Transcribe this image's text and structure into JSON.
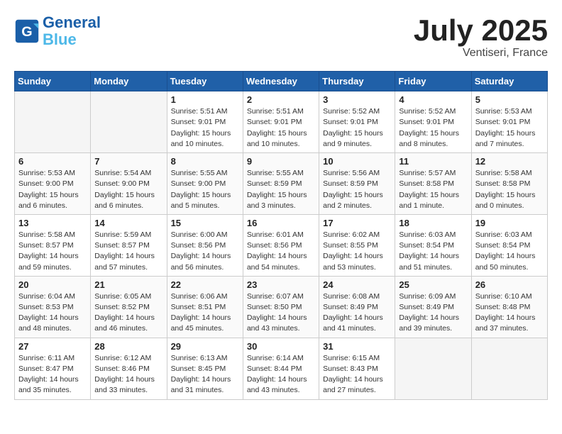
{
  "header": {
    "logo_line1": "General",
    "logo_line2": "Blue",
    "month": "July 2025",
    "location": "Ventiseri, France"
  },
  "weekdays": [
    "Sunday",
    "Monday",
    "Tuesday",
    "Wednesday",
    "Thursday",
    "Friday",
    "Saturday"
  ],
  "weeks": [
    [
      {
        "day": null
      },
      {
        "day": null
      },
      {
        "day": "1",
        "sunrise": "Sunrise: 5:51 AM",
        "sunset": "Sunset: 9:01 PM",
        "daylight": "Daylight: 15 hours and 10 minutes."
      },
      {
        "day": "2",
        "sunrise": "Sunrise: 5:51 AM",
        "sunset": "Sunset: 9:01 PM",
        "daylight": "Daylight: 15 hours and 10 minutes."
      },
      {
        "day": "3",
        "sunrise": "Sunrise: 5:52 AM",
        "sunset": "Sunset: 9:01 PM",
        "daylight": "Daylight: 15 hours and 9 minutes."
      },
      {
        "day": "4",
        "sunrise": "Sunrise: 5:52 AM",
        "sunset": "Sunset: 9:01 PM",
        "daylight": "Daylight: 15 hours and 8 minutes."
      },
      {
        "day": "5",
        "sunrise": "Sunrise: 5:53 AM",
        "sunset": "Sunset: 9:01 PM",
        "daylight": "Daylight: 15 hours and 7 minutes."
      }
    ],
    [
      {
        "day": "6",
        "sunrise": "Sunrise: 5:53 AM",
        "sunset": "Sunset: 9:00 PM",
        "daylight": "Daylight: 15 hours and 6 minutes."
      },
      {
        "day": "7",
        "sunrise": "Sunrise: 5:54 AM",
        "sunset": "Sunset: 9:00 PM",
        "daylight": "Daylight: 15 hours and 6 minutes."
      },
      {
        "day": "8",
        "sunrise": "Sunrise: 5:55 AM",
        "sunset": "Sunset: 9:00 PM",
        "daylight": "Daylight: 15 hours and 5 minutes."
      },
      {
        "day": "9",
        "sunrise": "Sunrise: 5:55 AM",
        "sunset": "Sunset: 8:59 PM",
        "daylight": "Daylight: 15 hours and 3 minutes."
      },
      {
        "day": "10",
        "sunrise": "Sunrise: 5:56 AM",
        "sunset": "Sunset: 8:59 PM",
        "daylight": "Daylight: 15 hours and 2 minutes."
      },
      {
        "day": "11",
        "sunrise": "Sunrise: 5:57 AM",
        "sunset": "Sunset: 8:58 PM",
        "daylight": "Daylight: 15 hours and 1 minute."
      },
      {
        "day": "12",
        "sunrise": "Sunrise: 5:58 AM",
        "sunset": "Sunset: 8:58 PM",
        "daylight": "Daylight: 15 hours and 0 minutes."
      }
    ],
    [
      {
        "day": "13",
        "sunrise": "Sunrise: 5:58 AM",
        "sunset": "Sunset: 8:57 PM",
        "daylight": "Daylight: 14 hours and 59 minutes."
      },
      {
        "day": "14",
        "sunrise": "Sunrise: 5:59 AM",
        "sunset": "Sunset: 8:57 PM",
        "daylight": "Daylight: 14 hours and 57 minutes."
      },
      {
        "day": "15",
        "sunrise": "Sunrise: 6:00 AM",
        "sunset": "Sunset: 8:56 PM",
        "daylight": "Daylight: 14 hours and 56 minutes."
      },
      {
        "day": "16",
        "sunrise": "Sunrise: 6:01 AM",
        "sunset": "Sunset: 8:56 PM",
        "daylight": "Daylight: 14 hours and 54 minutes."
      },
      {
        "day": "17",
        "sunrise": "Sunrise: 6:02 AM",
        "sunset": "Sunset: 8:55 PM",
        "daylight": "Daylight: 14 hours and 53 minutes."
      },
      {
        "day": "18",
        "sunrise": "Sunrise: 6:03 AM",
        "sunset": "Sunset: 8:54 PM",
        "daylight": "Daylight: 14 hours and 51 minutes."
      },
      {
        "day": "19",
        "sunrise": "Sunrise: 6:03 AM",
        "sunset": "Sunset: 8:54 PM",
        "daylight": "Daylight: 14 hours and 50 minutes."
      }
    ],
    [
      {
        "day": "20",
        "sunrise": "Sunrise: 6:04 AM",
        "sunset": "Sunset: 8:53 PM",
        "daylight": "Daylight: 14 hours and 48 minutes."
      },
      {
        "day": "21",
        "sunrise": "Sunrise: 6:05 AM",
        "sunset": "Sunset: 8:52 PM",
        "daylight": "Daylight: 14 hours and 46 minutes."
      },
      {
        "day": "22",
        "sunrise": "Sunrise: 6:06 AM",
        "sunset": "Sunset: 8:51 PM",
        "daylight": "Daylight: 14 hours and 45 minutes."
      },
      {
        "day": "23",
        "sunrise": "Sunrise: 6:07 AM",
        "sunset": "Sunset: 8:50 PM",
        "daylight": "Daylight: 14 hours and 43 minutes."
      },
      {
        "day": "24",
        "sunrise": "Sunrise: 6:08 AM",
        "sunset": "Sunset: 8:49 PM",
        "daylight": "Daylight: 14 hours and 41 minutes."
      },
      {
        "day": "25",
        "sunrise": "Sunrise: 6:09 AM",
        "sunset": "Sunset: 8:49 PM",
        "daylight": "Daylight: 14 hours and 39 minutes."
      },
      {
        "day": "26",
        "sunrise": "Sunrise: 6:10 AM",
        "sunset": "Sunset: 8:48 PM",
        "daylight": "Daylight: 14 hours and 37 minutes."
      }
    ],
    [
      {
        "day": "27",
        "sunrise": "Sunrise: 6:11 AM",
        "sunset": "Sunset: 8:47 PM",
        "daylight": "Daylight: 14 hours and 35 minutes."
      },
      {
        "day": "28",
        "sunrise": "Sunrise: 6:12 AM",
        "sunset": "Sunset: 8:46 PM",
        "daylight": "Daylight: 14 hours and 33 minutes."
      },
      {
        "day": "29",
        "sunrise": "Sunrise: 6:13 AM",
        "sunset": "Sunset: 8:45 PM",
        "daylight": "Daylight: 14 hours and 31 minutes."
      },
      {
        "day": "30",
        "sunrise": "Sunrise: 6:14 AM",
        "sunset": "Sunset: 8:44 PM",
        "daylight": "Daylight: 14 hours and 43 minutes."
      },
      {
        "day": "31",
        "sunrise": "Sunrise: 6:15 AM",
        "sunset": "Sunset: 8:43 PM",
        "daylight": "Daylight: 14 hours and 27 minutes."
      },
      {
        "day": null
      },
      {
        "day": null
      }
    ]
  ]
}
